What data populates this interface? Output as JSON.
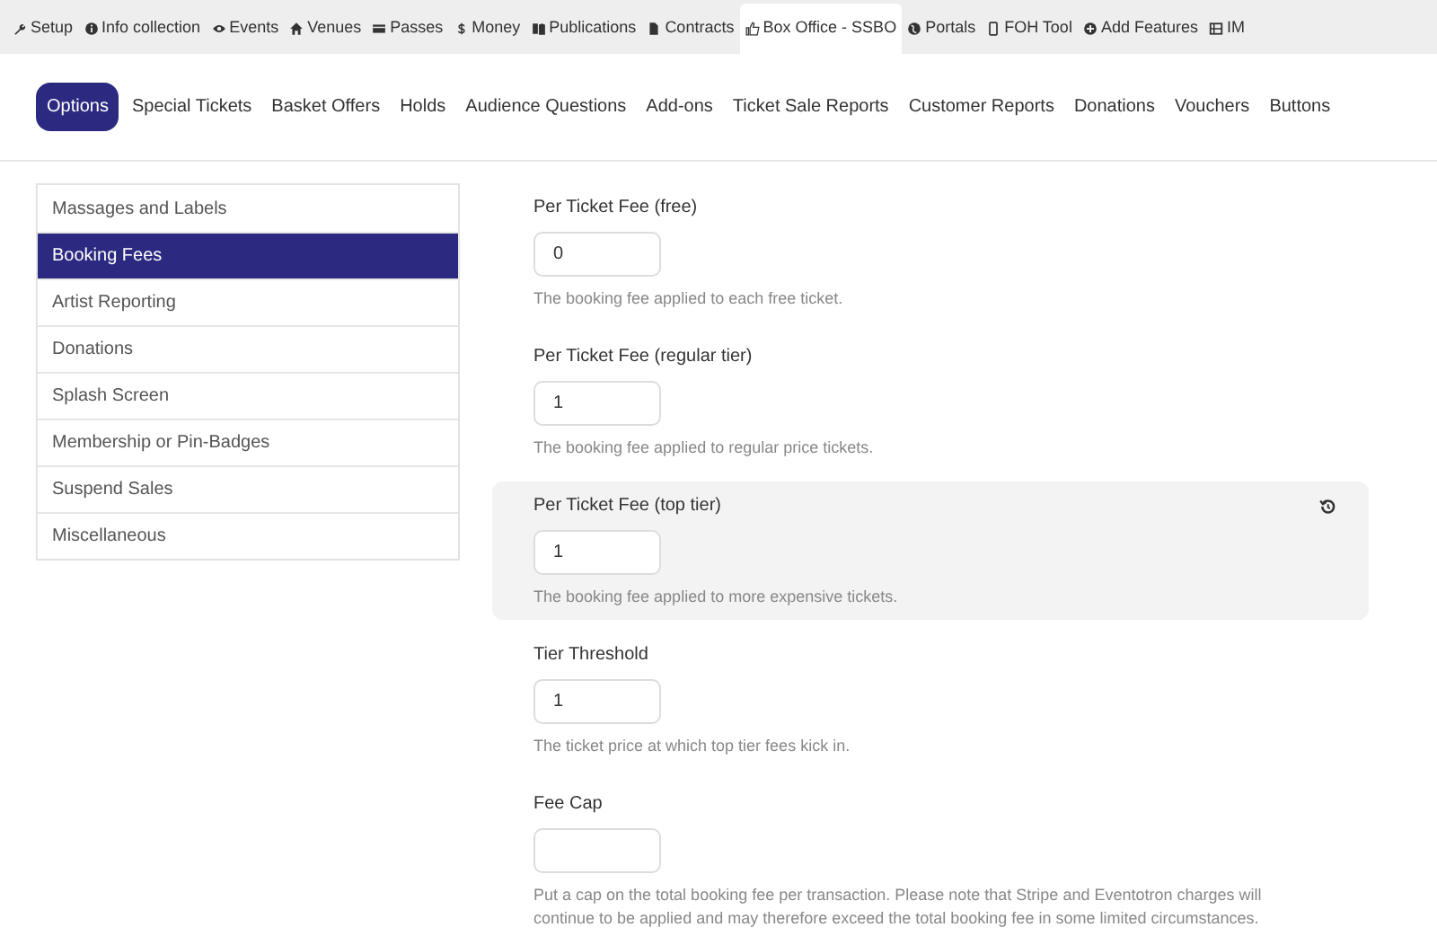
{
  "top_nav": [
    {
      "label": "Setup",
      "selected": false
    },
    {
      "label": "Info collection",
      "selected": false
    },
    {
      "label": "Events",
      "selected": false
    },
    {
      "label": "Venues",
      "selected": false
    },
    {
      "label": "Passes",
      "selected": false
    },
    {
      "label": "Money",
      "selected": false
    },
    {
      "label": "Publications",
      "selected": false
    },
    {
      "label": "Contracts",
      "selected": false
    },
    {
      "label": "Box Office - SSBO",
      "selected": true
    },
    {
      "label": "Portals",
      "selected": false
    },
    {
      "label": "FOH Tool",
      "selected": false
    },
    {
      "label": "Add Features",
      "selected": false
    },
    {
      "label": "IM",
      "selected": false
    }
  ],
  "sub_tabs": [
    {
      "label": "Options",
      "selected": true
    },
    {
      "label": "Special Tickets",
      "selected": false
    },
    {
      "label": "Basket Offers",
      "selected": false
    },
    {
      "label": "Holds",
      "selected": false
    },
    {
      "label": "Audience Questions",
      "selected": false
    },
    {
      "label": "Add-ons",
      "selected": false
    },
    {
      "label": "Ticket Sale Reports",
      "selected": false
    },
    {
      "label": "Customer Reports",
      "selected": false
    },
    {
      "label": "Donations",
      "selected": false
    },
    {
      "label": "Vouchers",
      "selected": false
    },
    {
      "label": "Buttons",
      "selected": false
    }
  ],
  "sidebar": {
    "items": [
      {
        "label": "Massages and Labels",
        "selected": false
      },
      {
        "label": "Booking Fees",
        "selected": true
      },
      {
        "label": "Artist Reporting",
        "selected": false
      },
      {
        "label": "Donations",
        "selected": false
      },
      {
        "label": "Splash Screen",
        "selected": false
      },
      {
        "label": "Membership or Pin-Badges",
        "selected": false
      },
      {
        "label": "Suspend Sales",
        "selected": false
      },
      {
        "label": "Miscellaneous",
        "selected": false
      }
    ]
  },
  "fields": [
    {
      "label": "Per Ticket Fee (free)",
      "value": "0",
      "help": "The booking fee applied to each free ticket.",
      "modified": false
    },
    {
      "label": "Per Ticket Fee (regular tier)",
      "value": "1",
      "help": "The booking fee applied to regular price tickets.",
      "modified": false
    },
    {
      "label": "Per Ticket Fee (top tier)",
      "value": "1",
      "help": "The booking fee applied to more expensive tickets.",
      "modified": true
    },
    {
      "label": "Tier Threshold",
      "value": "1",
      "help": "The ticket price at which top tier fees kick in.",
      "modified": false
    },
    {
      "label": "Fee Cap",
      "help": "Put a cap on the total booking fee per transaction. Please note that Stripe and Eventotron charges will continue to be applied and may therefore exceed the total booking fee in some limited circumstances.",
      "modified": false
    }
  ]
}
